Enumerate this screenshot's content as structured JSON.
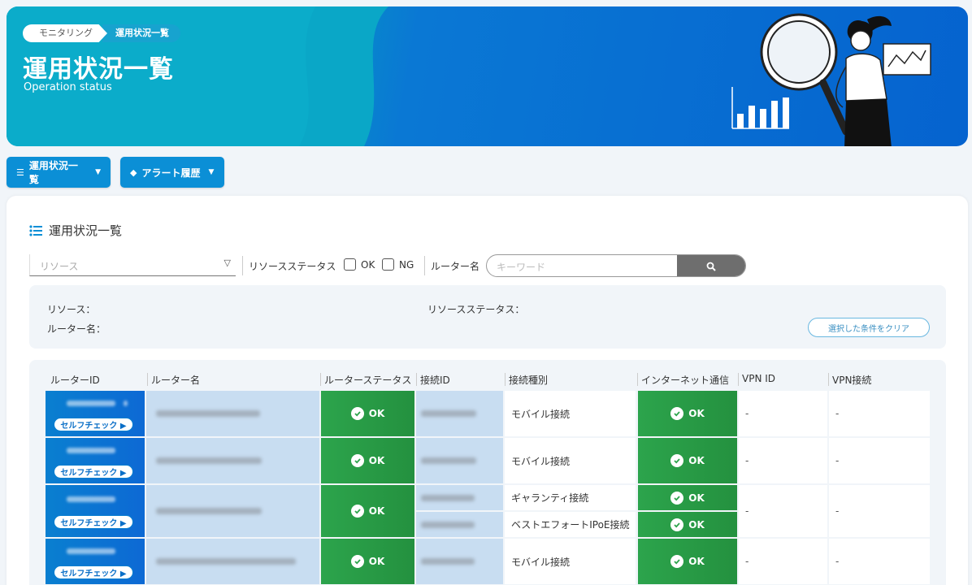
{
  "header": {
    "breadcrumb": [
      "モニタリング",
      "運用状況一覧"
    ],
    "title": "運用状況一覧",
    "subtitle": "Operation status"
  },
  "nav": {
    "status_menu": "運用状況一覧",
    "alert_menu": "アラート履歴"
  },
  "card": {
    "title": "運用状況一覧"
  },
  "filters": {
    "resource_placeholder": "リソース",
    "resource_status_label": "リソースステータス",
    "ok_label": "OK",
    "ng_label": "NG",
    "router_name_label": "ルーター名",
    "keyword_placeholder": "キーワード"
  },
  "summary": {
    "resource_label": "リソース：",
    "router_name_label": "ルーター名：",
    "resource_status_label": "リソースステータス：",
    "clear_button": "選択した条件をクリア"
  },
  "table": {
    "headers": [
      "ルーターID",
      "ルーター名",
      "ルーターステータス",
      "接続ID",
      "接続種別",
      "インターネット通信",
      "VPN ID",
      "VPN接続"
    ],
    "selfcheck_label": "セルフチェック ▶",
    "rows": [
      {
        "router_status": "OK",
        "connections": [
          {
            "type": "モバイル接続",
            "internet": "OK"
          }
        ],
        "vpn_id": "-",
        "vpn_conn": "-"
      },
      {
        "router_status": "OK",
        "connections": [
          {
            "type": "モバイル接続",
            "internet": "OK"
          }
        ],
        "vpn_id": "-",
        "vpn_conn": "-"
      },
      {
        "router_status": "OK",
        "connections": [
          {
            "type": "ギャランティ接続",
            "internet": "OK"
          },
          {
            "type": "ベストエフォートIPoE接続",
            "internet": "OK"
          }
        ],
        "vpn_id": "-",
        "vpn_conn": "-"
      },
      {
        "router_status": "OK",
        "connections": [
          {
            "type": "モバイル接続",
            "internet": "OK"
          }
        ],
        "vpn_id": "-",
        "vpn_conn": "-"
      }
    ]
  },
  "colors": {
    "accent": "#0b8fd6",
    "ok_green": "#2ca44c",
    "light_blue": "#c8ddf1"
  }
}
